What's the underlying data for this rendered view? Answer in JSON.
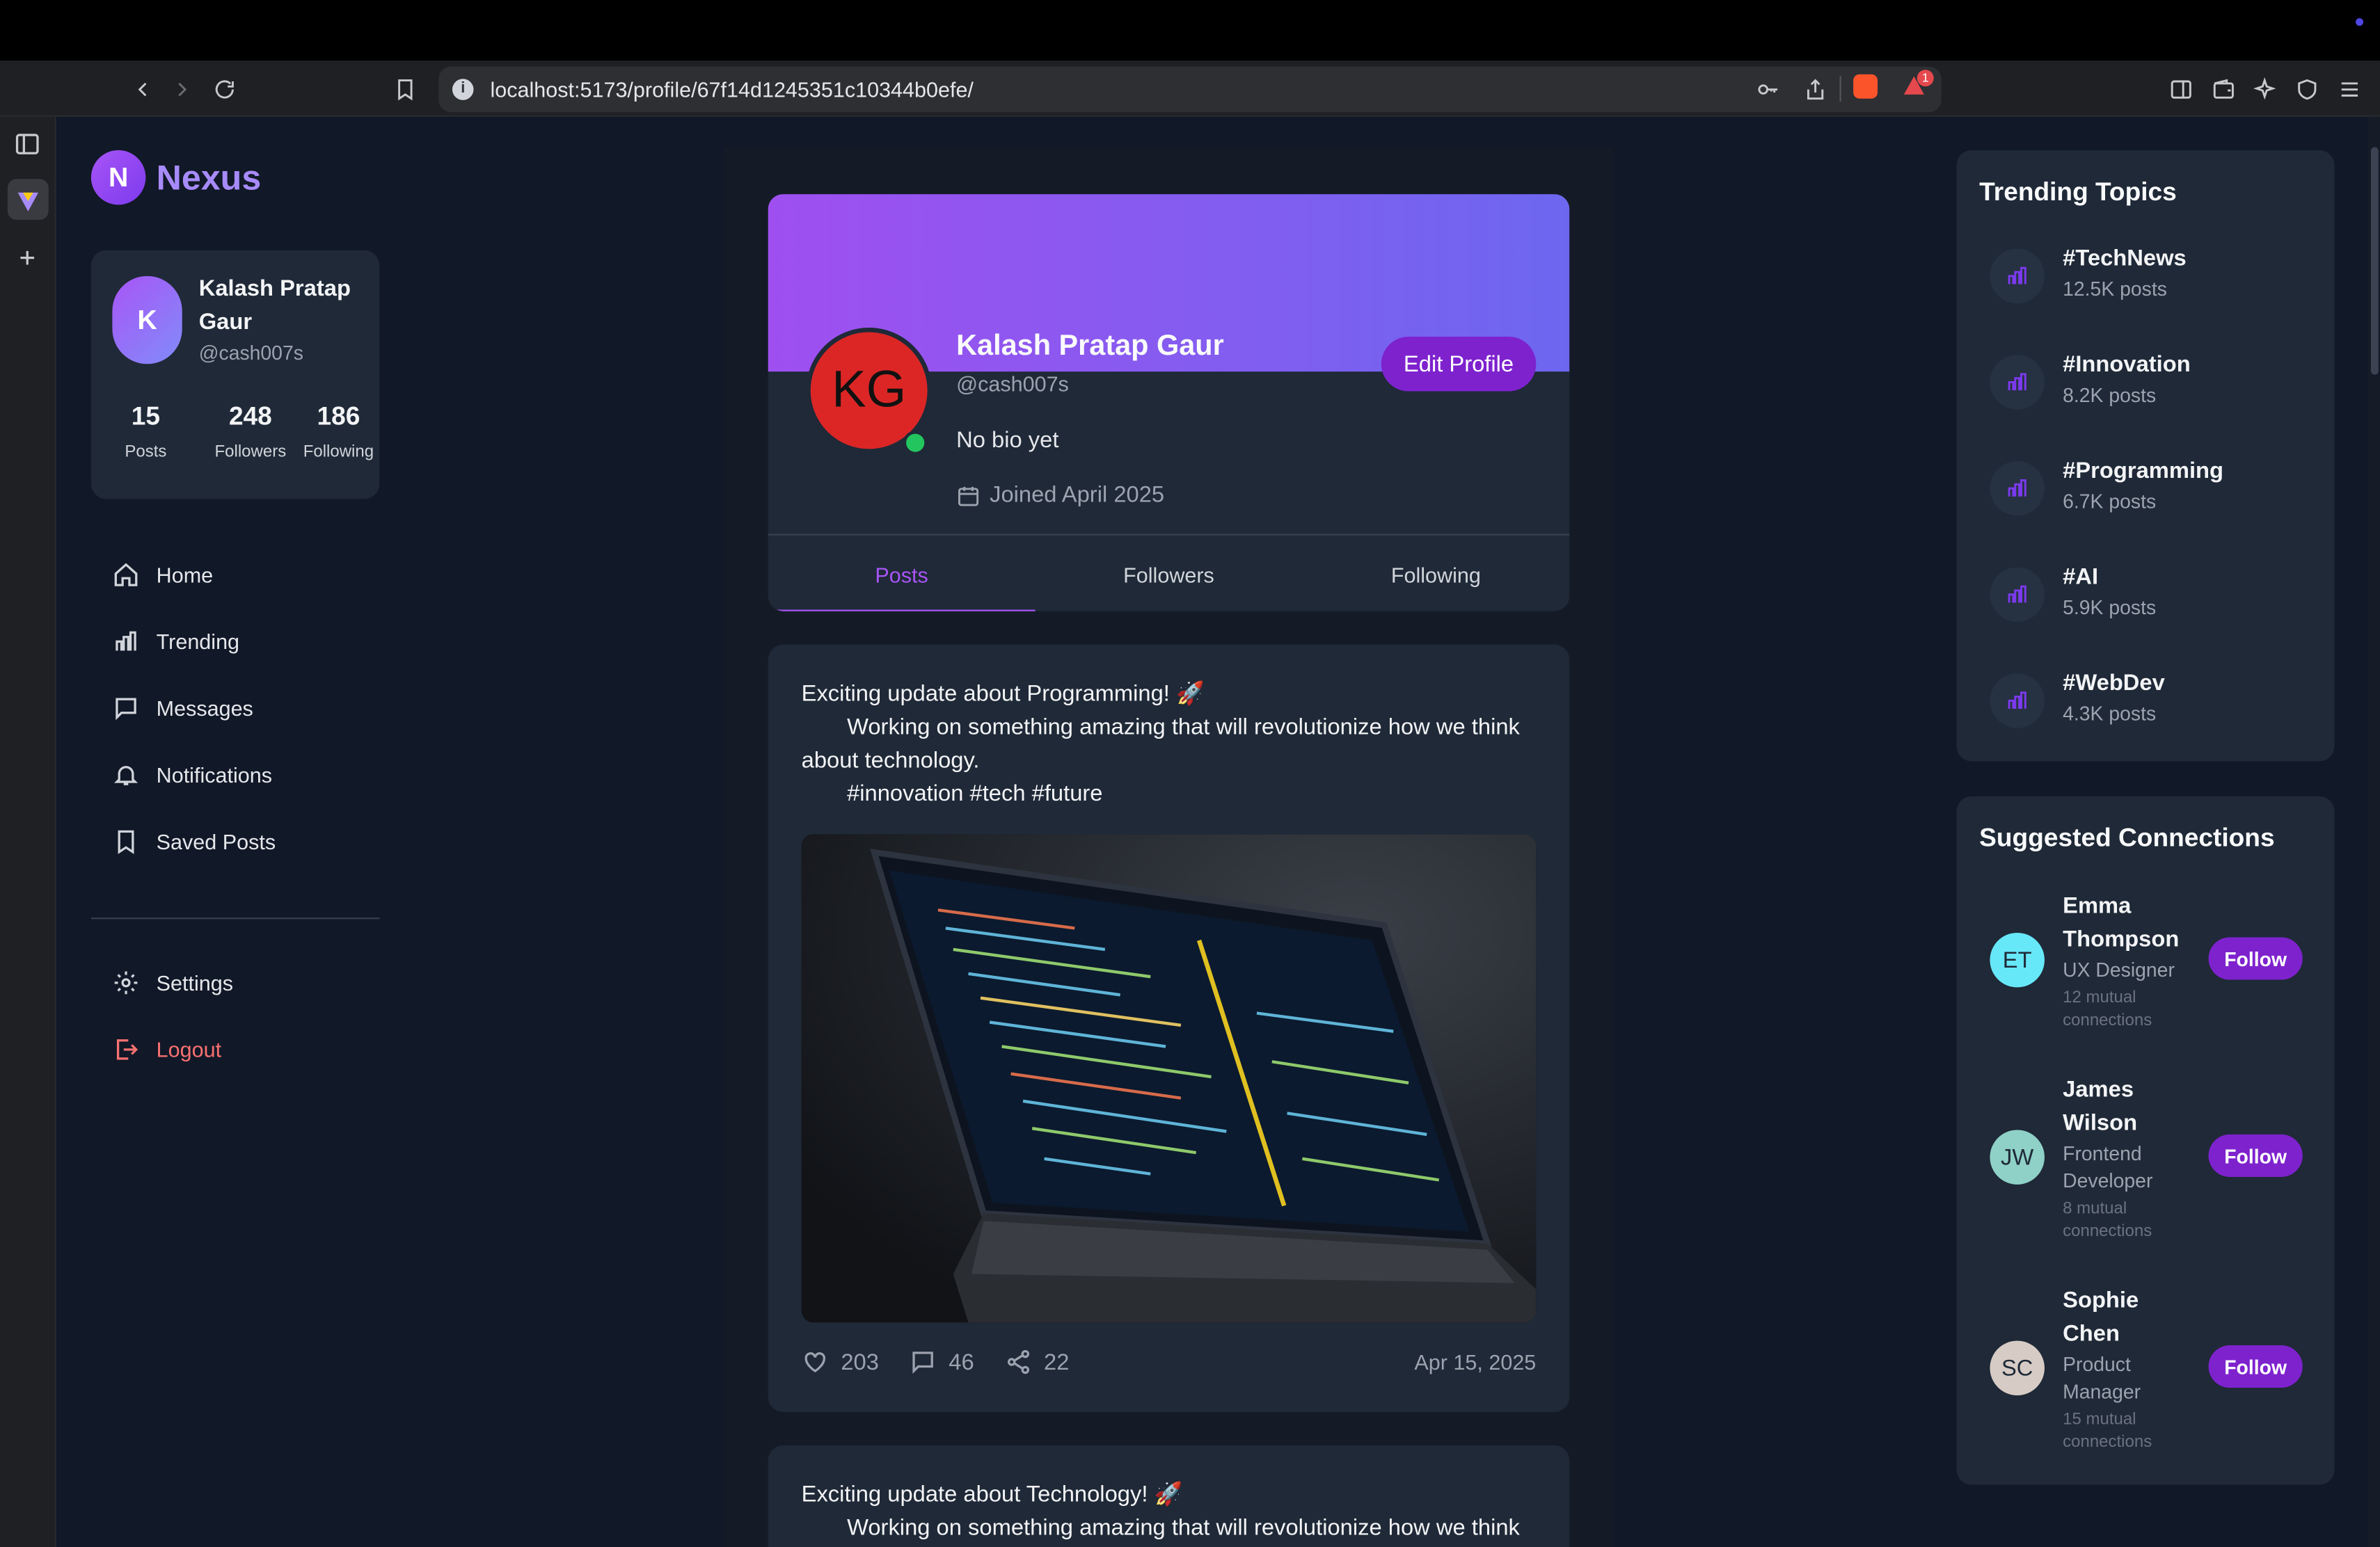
{
  "browser": {
    "url": "localhost:5173/profile/67f14d1245351c10344b0efe/",
    "notification_badge": "1"
  },
  "app": {
    "logo_letter": "N",
    "brand": "Nexus"
  },
  "user_card": {
    "avatar_letter": "K",
    "name": "Kalash Pratap Gaur",
    "handle": "@cash007s",
    "stats": [
      {
        "value": "15",
        "label": "Posts"
      },
      {
        "value": "248",
        "label": "Followers"
      },
      {
        "value": "186",
        "label": "Following"
      }
    ]
  },
  "nav": {
    "items": [
      {
        "label": "Home",
        "icon": "home-icon"
      },
      {
        "label": "Trending",
        "icon": "bar-chart-icon"
      },
      {
        "label": "Messages",
        "icon": "message-icon"
      },
      {
        "label": "Notifications",
        "icon": "bell-icon"
      },
      {
        "label": "Saved Posts",
        "icon": "bookmark-icon"
      }
    ],
    "settings": "Settings",
    "logout": "Logout"
  },
  "profile": {
    "initials": "KG",
    "name": "Kalash Pratap Gaur",
    "handle": "@cash007s",
    "edit_label": "Edit Profile",
    "bio": "No bio yet",
    "joined": "Joined April 2025",
    "tabs": [
      "Posts",
      "Followers",
      "Following"
    ],
    "active_tab": "Posts"
  },
  "posts": [
    {
      "title": "Exciting update about Programming! 🚀",
      "body": "Working on something amazing that will revolutionize how we think about technology.",
      "tags": "#innovation #tech #future",
      "likes": "203",
      "comments": "46",
      "shares": "22",
      "date": "Apr 15, 2025"
    },
    {
      "title": "Exciting update about Technology! 🚀",
      "body": "Working on something amazing that will revolutionize how we think"
    }
  ],
  "trending": {
    "title": "Trending Topics",
    "topics": [
      {
        "tag": "#TechNews",
        "count": "12.5K posts"
      },
      {
        "tag": "#Innovation",
        "count": "8.2K posts"
      },
      {
        "tag": "#Programming",
        "count": "6.7K posts"
      },
      {
        "tag": "#AI",
        "count": "5.9K posts"
      },
      {
        "tag": "#WebDev",
        "count": "4.3K posts"
      }
    ]
  },
  "suggestions": {
    "title": "Suggested Connections",
    "follow_label": "Follow",
    "people": [
      {
        "initials": "ET",
        "name": "Emma Thompson",
        "role": "UX Designer",
        "mutual": "12 mutual connections",
        "color": "#67e8f9"
      },
      {
        "initials": "JW",
        "name": "James Wilson",
        "role": "Frontend Developer",
        "mutual": "8 mutual connections",
        "color": "#8fd1c7"
      },
      {
        "initials": "SC",
        "name": "Sophie Chen",
        "role": "Product Manager",
        "mutual": "15 mutual connections",
        "color": "#d6ccc5"
      }
    ]
  },
  "colors": {
    "accent": "#7e22ce",
    "accent_text": "#a855f7",
    "background": "#111827",
    "card": "#1f2937",
    "logout": "#f87171"
  }
}
